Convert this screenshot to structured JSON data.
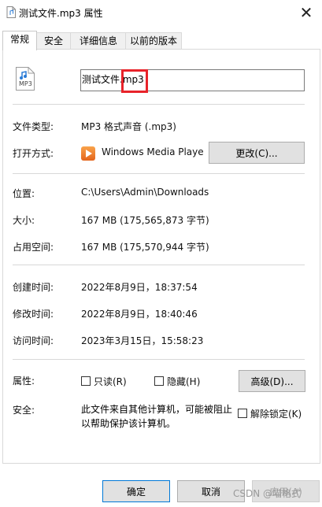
{
  "window": {
    "title": "测试文件.mp3 属性",
    "close_glyph": "✕"
  },
  "tabs": [
    {
      "label": "常规",
      "active": true
    },
    {
      "label": "安全",
      "active": false
    },
    {
      "label": "详细信息",
      "active": false
    },
    {
      "label": "以前的版本",
      "active": false
    }
  ],
  "file": {
    "icon": "mp3-file-icon",
    "icon_caption": "MP3",
    "name_part1": "测试文件.",
    "name_part2": "mp3"
  },
  "props": {
    "type_label": "文件类型:",
    "type_value": "MP3 格式声音 (.mp3)",
    "open_label": "打开方式:",
    "open_value": "Windows Media Playe",
    "change_button": "更改(C)...",
    "location_label": "位置:",
    "location_value": "C:\\Users\\Admin\\Downloads",
    "size_label": "大小:",
    "size_value": "167 MB (175,565,873 字节)",
    "disk_label": "占用空间:",
    "disk_value": "167 MB (175,570,944 字节)",
    "created_label": "创建时间:",
    "created_value": "2022年8月9日，18:37:54",
    "modified_label": "修改时间:",
    "modified_value": "2022年8月9日，18:40:46",
    "accessed_label": "访问时间:",
    "accessed_value": "2023年3月15日，15:58:23",
    "attr_label": "属性:",
    "readonly_label": "只读(R)",
    "hidden_label": "隐藏(H)",
    "advanced_button": "高级(D)...",
    "security_label": "安全:",
    "security_text": "此文件来自其他计算机，可能被阻止以帮助保护该计算机。",
    "unblock_label": "解除锁定(K)"
  },
  "footer": {
    "ok": "确定",
    "cancel": "取消",
    "apply": "应用(A)"
  },
  "watermark": "CSDN @喵格式",
  "colors": {
    "highlight": "#e8232a",
    "primary_border": "#0078d7",
    "player_icon": "#e4641b"
  }
}
